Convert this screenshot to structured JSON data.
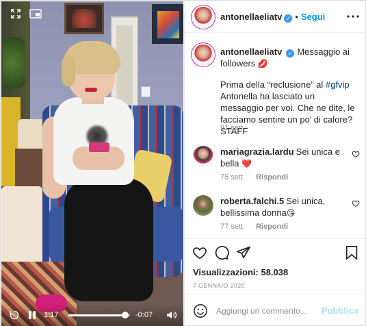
{
  "video": {
    "current_time": "1:17",
    "remaining_time": "-0:07",
    "progress": 0.92,
    "icons": {
      "expand": "expand-icon",
      "pip": "picture-in-picture-icon",
      "replay": "replay-10-icon",
      "pause": "pause-icon",
      "volume": "volume-icon"
    }
  },
  "header": {
    "username": "antonellaeliatv",
    "follow_label": "Segui",
    "separator": "•"
  },
  "caption": {
    "username": "antonellaeliatv",
    "first_line": "Messaggio ai followers",
    "lips_emoji": "💋",
    "body_before_tag": "Prima della “reclusione” al ",
    "hashtag": "#gfvip",
    "body_after_tag": " Antonella ha lasciato un messaggio per voi. Che ne dite, le facciamo sentire un po’ di calore? STAFF",
    "time": "91 sett."
  },
  "comments": [
    {
      "username": "mariagrazia.lardu",
      "text": "Sei unica e bella",
      "emoji": "❤️",
      "time": "75 sett.",
      "reply_label": "Rispondi"
    },
    {
      "username": "roberta.falchi.5",
      "text": "Sei unica, bellissima donna",
      "emoji": "😘",
      "time": "77 sett.",
      "reply_label": "Rispondi"
    }
  ],
  "stats": {
    "views_label": "Visualizzazioni:",
    "views_value": "58.038",
    "date": "7 gennaio 2020"
  },
  "add_comment": {
    "placeholder": "Aggiungi un commento...",
    "publish_label": "Pubblica"
  },
  "colors": {
    "link_blue": "#0095f6",
    "hashtag_blue": "#00376b",
    "muted": "#8e8e8e",
    "publish_disabled": "#b2dffc",
    "verified": "#3897f0"
  }
}
